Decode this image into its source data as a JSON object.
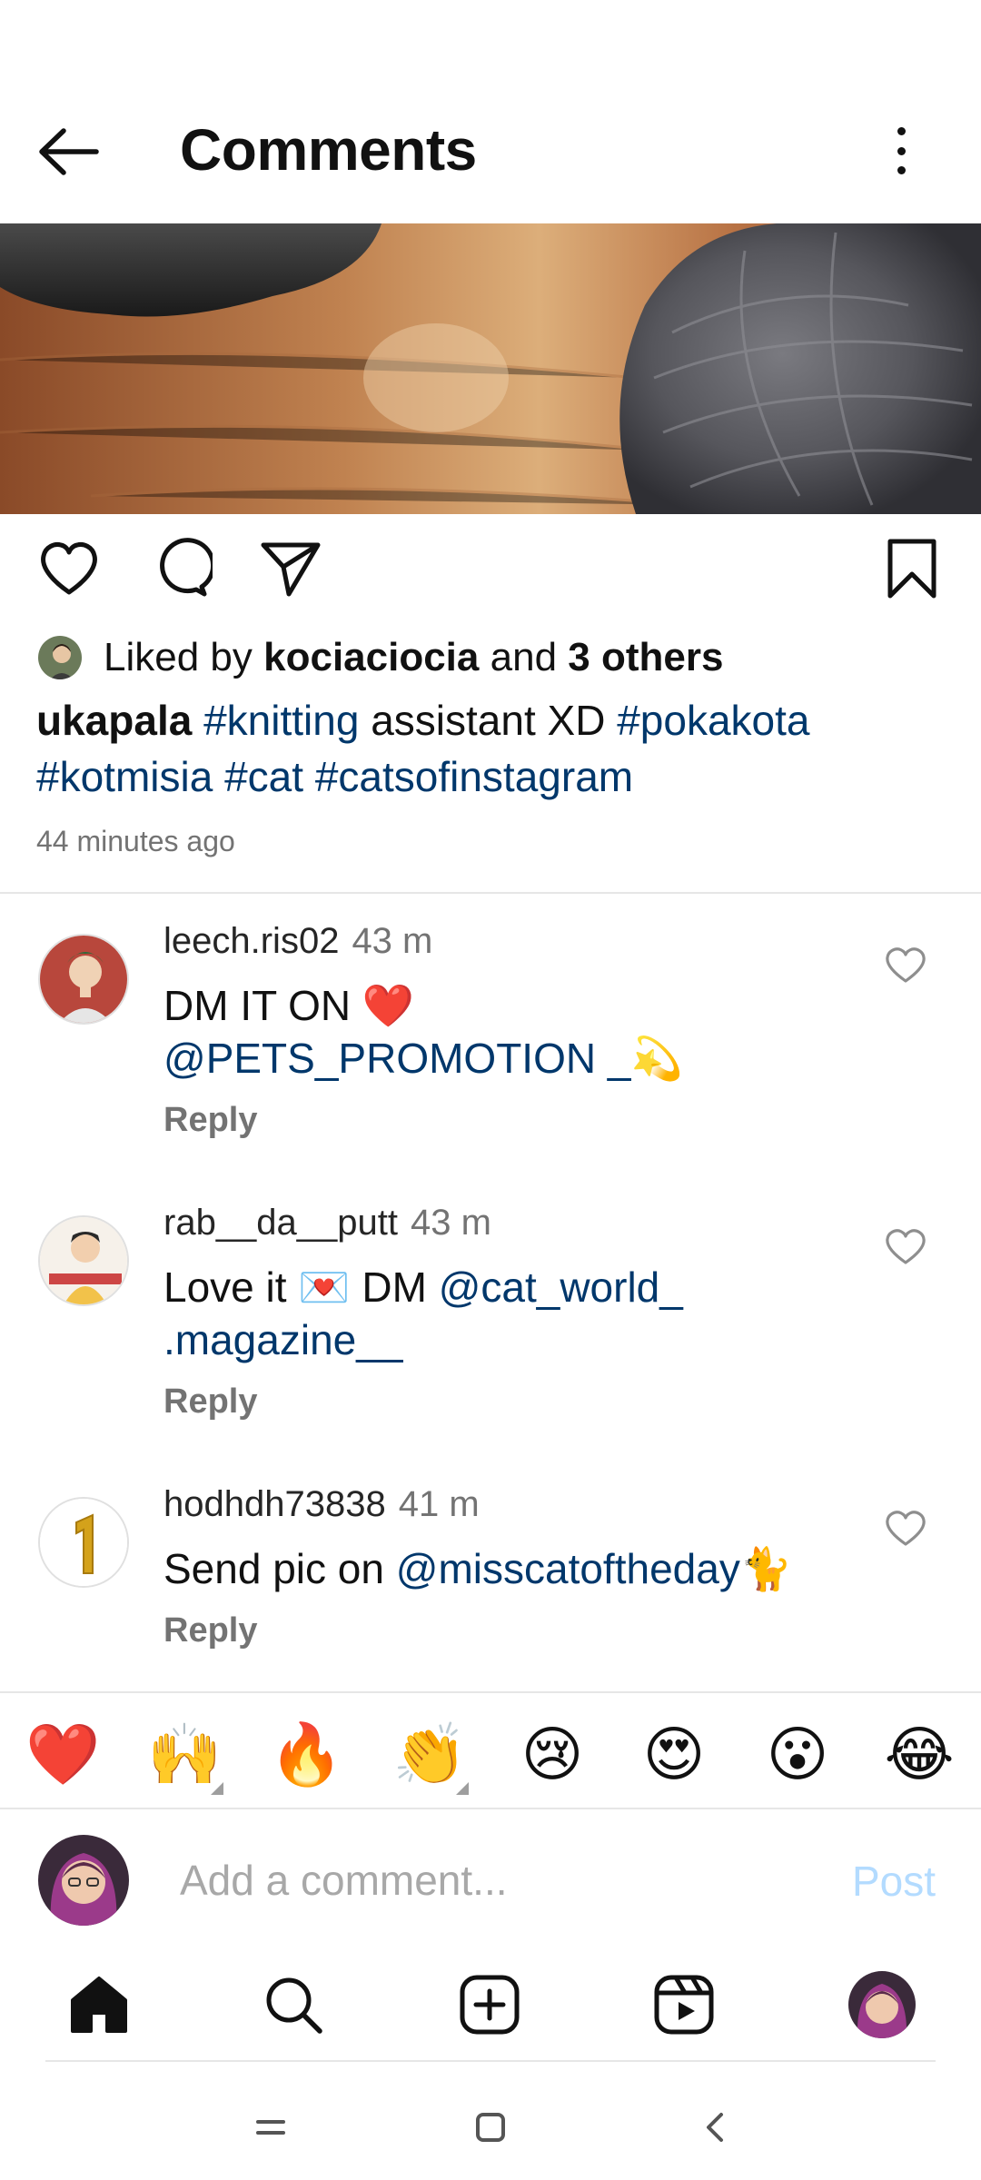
{
  "header": {
    "title": "Comments"
  },
  "post": {
    "liked_by_prefix": "Liked by",
    "liked_by_user": "kociaciocia",
    "liked_by_and": "and",
    "liked_by_others": "3 others",
    "caption_user": "ukapala",
    "caption_tag1": "#knitting",
    "caption_text": "assistant XD",
    "caption_tag2": "#pokakota",
    "caption_tag3": "#kotmisia",
    "caption_tag4": "#cat",
    "caption_tag5": "#catsofinstagram",
    "time_ago": "44 minutes ago"
  },
  "comments": [
    {
      "user": "leech.ris02",
      "time": "43 m",
      "text_before": "DM IT ON ❤️",
      "mention": "@PETS_PROMOTION _💫",
      "text_after": "",
      "reply": "Reply"
    },
    {
      "user": "rab__da__putt",
      "time": "43 m",
      "text_before": "Love it 💌 DM",
      "mention": "@cat_world_ .magazine__",
      "text_after": "",
      "reply": "Reply"
    },
    {
      "user": "hodhdh73838",
      "time": "41 m",
      "text_before": "Send pic on",
      "mention": "@misscatoftheday",
      "text_after": "🐈",
      "reply": "Reply"
    }
  ],
  "emoji_bar": [
    "❤️",
    "🙌",
    "🔥",
    "👏",
    "😢",
    "😍",
    "😮",
    "😂"
  ],
  "comment_input": {
    "placeholder": "Add a comment...",
    "post_label": "Post"
  },
  "colors": {
    "link": "#00376b",
    "muted": "#737373",
    "post_disabled": "#b3dbff"
  }
}
